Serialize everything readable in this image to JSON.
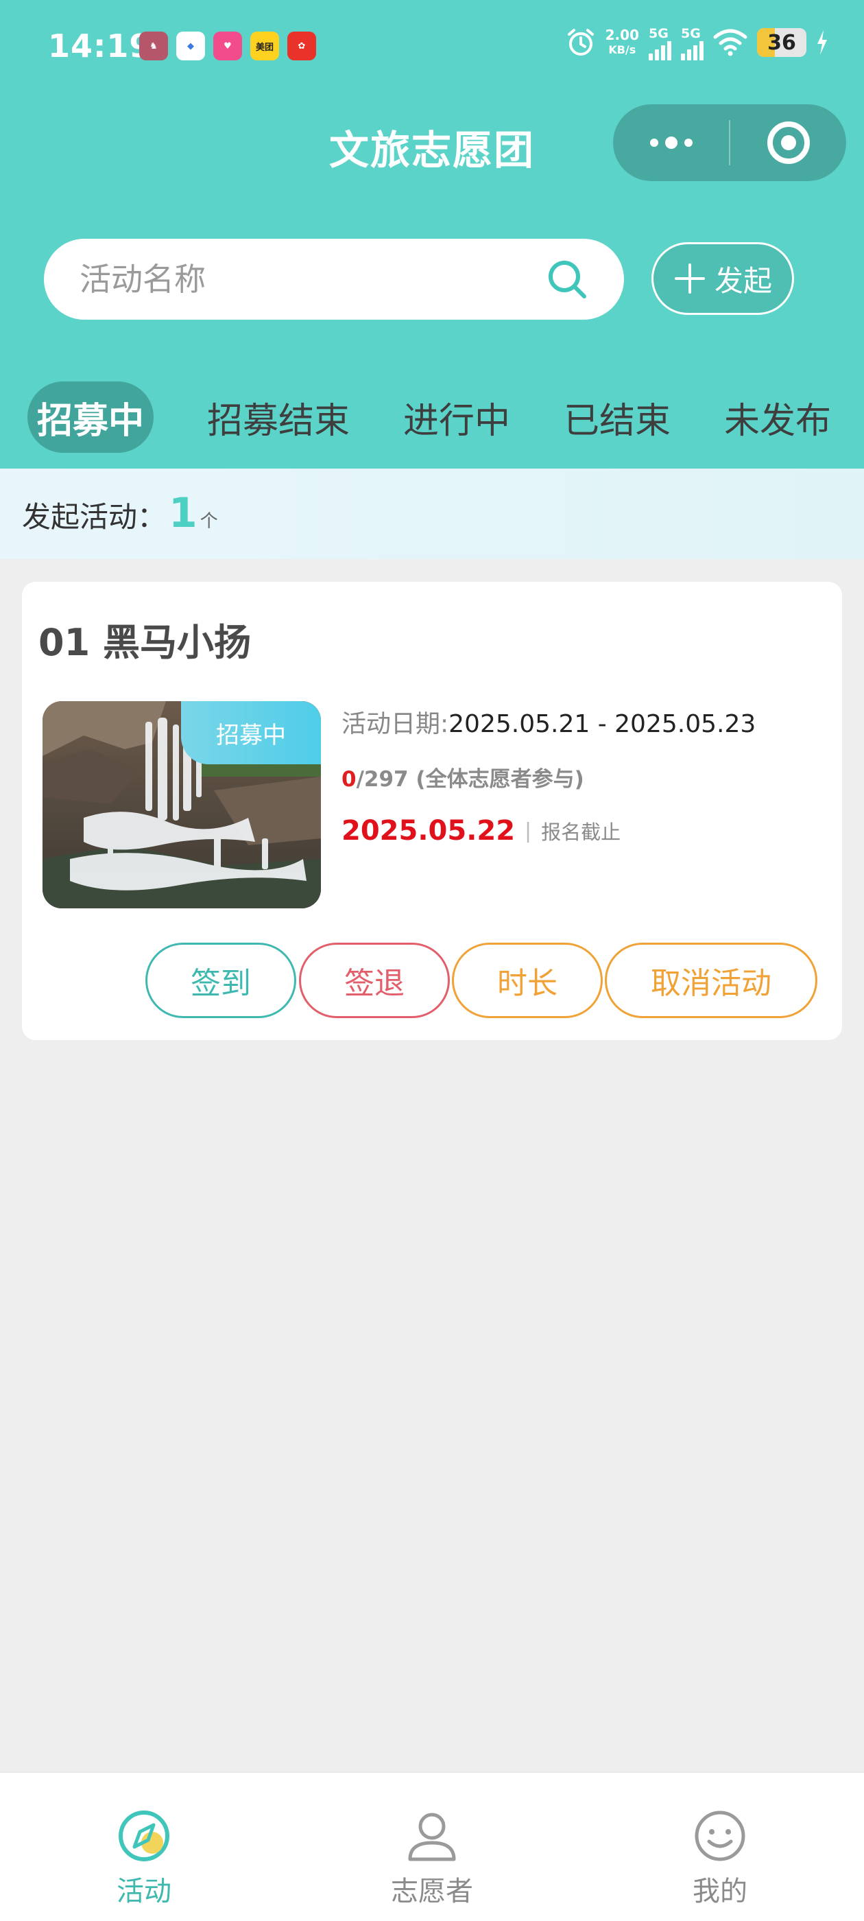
{
  "status_bar": {
    "time": "14:19",
    "app_icons": [
      "app-icon-1",
      "app-icon-2",
      "app-icon-3",
      "美团",
      "app-icon-5"
    ],
    "net_speed_value": "2.00",
    "net_speed_unit": "KB/s",
    "sim1": "5G",
    "sim2": "5G",
    "battery": "36"
  },
  "header": {
    "title": "文旅志愿团",
    "capsule": {
      "more_icon": "more-dots-icon",
      "close_icon": "target-icon"
    }
  },
  "search": {
    "placeholder": "活动名称",
    "value": ""
  },
  "start_button": {
    "label": "发起",
    "icon": "plus-icon"
  },
  "tabs": [
    {
      "label": "招募中",
      "active": true
    },
    {
      "label": "招募结束",
      "active": false
    },
    {
      "label": "进行中",
      "active": false
    },
    {
      "label": "已结束",
      "active": false
    },
    {
      "label": "未发布",
      "active": false
    }
  ],
  "summary": {
    "label": "发起活动：",
    "count": "1",
    "unit": "个"
  },
  "activity": {
    "title": "01 黑马小扬",
    "badge": "招募中",
    "date_label": "活动日期:",
    "date_range": "2025.05.21 - 2025.05.23",
    "enrolled": "0",
    "capacity_text": "/297 (全体志愿者参与)",
    "deadline_date": "2025.05.22",
    "deadline_sep": "|",
    "deadline_label": "报名截止",
    "buttons": {
      "checkin": "签到",
      "checkout": "签退",
      "duration": "时长",
      "cancel": "取消活动"
    }
  },
  "bottom_nav": [
    {
      "label": "活动",
      "icon": "compass-icon",
      "active": true
    },
    {
      "label": "志愿者",
      "icon": "person-icon",
      "active": false
    },
    {
      "label": "我的",
      "icon": "smiley-icon",
      "active": false
    }
  ],
  "colors": {
    "header_bg": "#5cd3c9",
    "accent": "#3fb9b0",
    "active_tab_bg": "#42a59b",
    "danger": "#e0111b",
    "orange": "#f0a236"
  }
}
